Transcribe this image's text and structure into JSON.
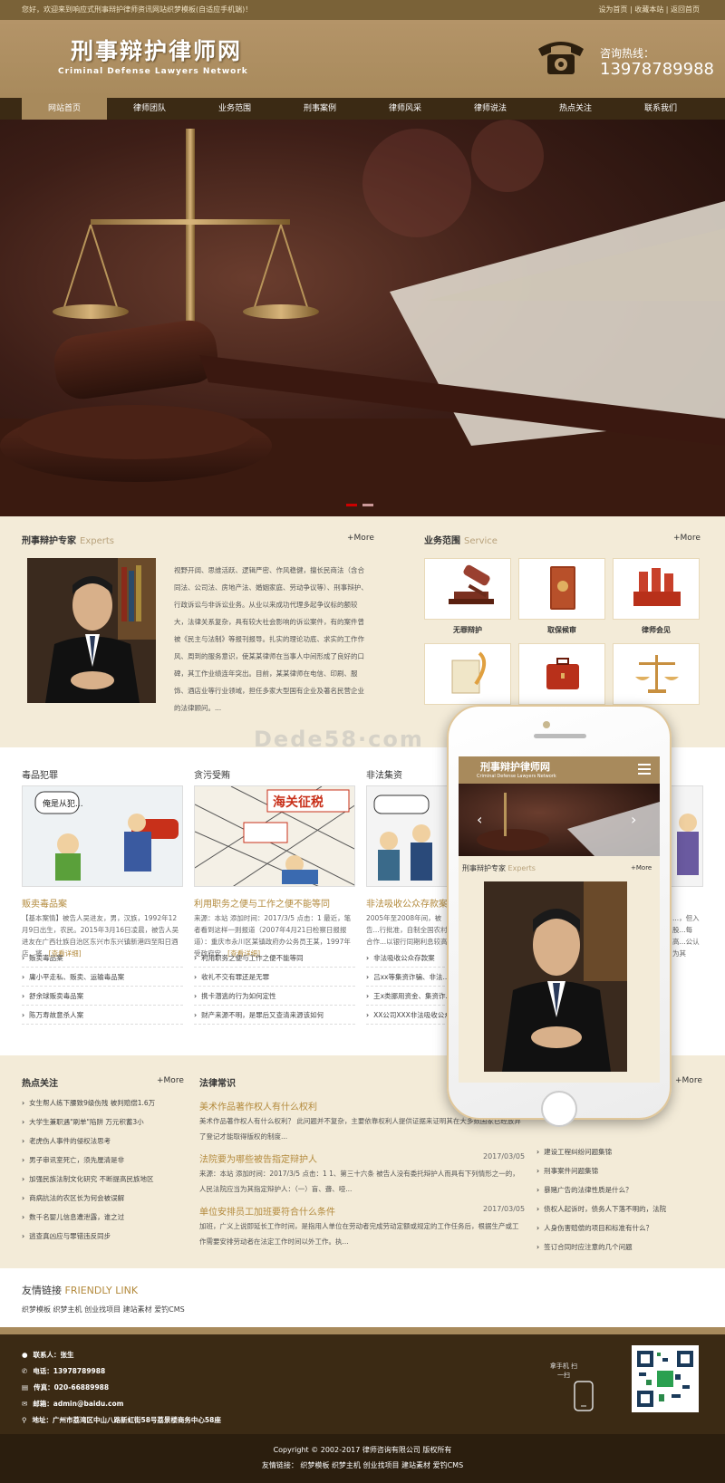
{
  "topbar": {
    "welcome": "您好，欢迎来到响应式刑事辩护律师资讯网站织梦模板(自适应手机端)！",
    "links": [
      "设为首页",
      "收藏本站",
      "返回首页"
    ]
  },
  "brand": {
    "cn": "刑事辩护律师网",
    "en": "Criminal Defense Lawyers Network"
  },
  "hotline": {
    "label": "咨询热线：",
    "number": "13978789988"
  },
  "nav": [
    "网站首页",
    "律师团队",
    "业务范围",
    "刑事案例",
    "律师风采",
    "律师说法",
    "热点关注",
    "联系我们"
  ],
  "experts": {
    "title": "刑事辩护专家",
    "title_en": "Experts",
    "more": "+More",
    "text": "视野开阔、思维活跃、逻辑严密、作风稳健，擅长民商法（含合同法、公司法、房地产法、婚姻家庭、劳动争议等）、刑事辩护、行政诉讼与非诉讼业务。从业以来成功代理多起争议标的额较大，法律关系复杂，具有较大社会影响的诉讼案件，有的案件曾被《民主与法制》等报刊报导。扎实的理论功底、求实的工作作风、周到的服务意识，使某某律师在当事人中间形成了良好的口碑，其工作业绩连年突出。目前，某某律师在电信、印刷、服饰、酒店业等行业领域，担任多家大型国有企业及著名民营企业的法律顾问。..."
  },
  "service": {
    "title": "业务范围",
    "title_en": "Service",
    "more": "+More",
    "items": [
      "无罪辩护",
      "取保候审",
      "律师会见",
      "刑",
      "",
      "决"
    ]
  },
  "cases": [
    {
      "cat": "毒品犯罪",
      "head": "贩卖毒品案",
      "desc": "【基本案情】被告人吴进友，男，汉族，1992年12月9日出生，农民。2015年3月16日凌晨，被告人吴进友在广西壮族自治区东兴市东兴镇新港四至阳日酒店，将...",
      "more": "[查看详细]",
      "list": [
        "贩卖毒品案",
        "庸小平走私、贩卖、运输毒品案",
        "舒余球贩卖毒品案",
        "陈万寿故意杀人案"
      ]
    },
    {
      "cat": "贪污受贿",
      "head": "利用职务之便与工作之便不能等同",
      "desc": "来源：本站 添加时间：2017/3/5 点击：1 最近，笔者看到这样一则报道（2007年4月21日检察日报报道）：重庆市永川区某镇政府办公务员王某，1997年受政府安...",
      "more": "[查看详细]",
      "list": [
        "利用职务之便与工作之便不能等同",
        "收礼不交有罪还是无罪",
        "携卡潜逃的行为如何定性",
        "财产来源不明，是罪后又查清来源该如何"
      ]
    },
    {
      "cat": "非法集资",
      "head": "非法吸收公众存款案",
      "desc": "2005年至2008年间，被告...行批准，自制全国农村合作...以银行同期利息较高",
      "more": "[查看详细]",
      "list": [
        "非法吸收公众存款案",
        "吕xx等集资诈骗、非法...",
        "王x类挪用资金、集资诈...",
        "XX公司XXX非法吸收公众..."
      ]
    },
    {
      "cat": "",
      "head": "",
      "desc": "...，但入股...每高...公认为其",
      "more": "",
      "list": []
    }
  ],
  "hot": {
    "title": "热点关注",
    "more": "+More",
    "list": [
      "女生帮人练下腰致9级伤残 被判赔偿1.6万",
      "大学生兼职遇\"刷单\"陷阱 万元积蓄3小",
      "老虎伤人事件的侵权法思考",
      "男子审讯室死亡，须先厘清是非",
      "加强民族法制文化研究 不断提高民族地区",
      "商病抗法的农区长为何会被误解",
      "数千名婴儿信息遭泄露，谁之过",
      "逃查真凶应与罪错违反同步"
    ]
  },
  "law": {
    "title": "法律常识",
    "items": [
      {
        "title": "美术作品著作权人有什么权利",
        "date": "",
        "text": "美术作品著作权人有什么权利？ 此问题并不复杂，主要依靠权利人提供证据来证明其在大多数国家已经放弃了登记才能取得版权的制度..."
      },
      {
        "title": "法院要为哪些被告指定辩护人",
        "date": "2017/03/05",
        "text": "来源：本站 添加时间：2017/3/5 点击：1 1、第三十六条 被告人没有委托辩护人而具有下列情形之一的，人民法院应当为其指定辩护人：（一）盲、聋、哑..."
      },
      {
        "title": "单位安排员工加班要符合什么条件",
        "date": "2017/03/05",
        "text": "加班，广义上说即延长工作时间，是指用人单位在劳动者完成劳动定额或规定的工作任务后，根据生产或工作需要安排劳动者在法定工作时间以外工作。执..."
      }
    ]
  },
  "right_col": {
    "more": "+More",
    "list": [
      "建设工程纠纷问题集锦",
      "刑事案件问题集锦",
      "暴赌广告的法律性质是什么？",
      "债权人起诉时，债务人下落不明的，法院",
      "人身伤害赔偿的项目和标准有什么？",
      "签订合同时应注意的几个问题"
    ]
  },
  "friend": {
    "title": "友情链接",
    "title_en": "FRIENDLY LINK",
    "links": [
      "织梦模板",
      "织梦主机",
      "创业找项目",
      "建站素材",
      "爱钓CMS"
    ]
  },
  "footer": {
    "items": [
      {
        "icon": "user-icon",
        "text": "联系人：张生"
      },
      {
        "icon": "phone-icon",
        "text": "电话：13978789988"
      },
      {
        "icon": "fax-icon",
        "text": "传真：020-66889988"
      },
      {
        "icon": "mail-icon",
        "text": "邮箱：admin@baidu.com"
      },
      {
        "icon": "location-icon",
        "text": "地址：广州市荔湾区中山八路新虹街58号荔景楼商务中心58座"
      }
    ],
    "scan_text": "拿手机 扫一扫",
    "copyright": "Copyright © 2002-2017 律师咨询有限公司 版权所有",
    "links_label": "友情链接：",
    "links": [
      "织梦模板",
      "织梦主机",
      "创业找项目",
      "建站素材",
      "爱钓CMS"
    ]
  },
  "watermark": "Dede58·com",
  "phone": {
    "brand": "刑事辩护律师网",
    "brand_en": "Criminal Defense Lawyers Network",
    "section": "刑事辩护专家",
    "section_en": "Experts",
    "more": "+More"
  },
  "colors": {
    "brand": "#a88a5c",
    "dark": "#3b2a14",
    "accent": "#b38a3c",
    "bg": "#f3ebd8"
  }
}
